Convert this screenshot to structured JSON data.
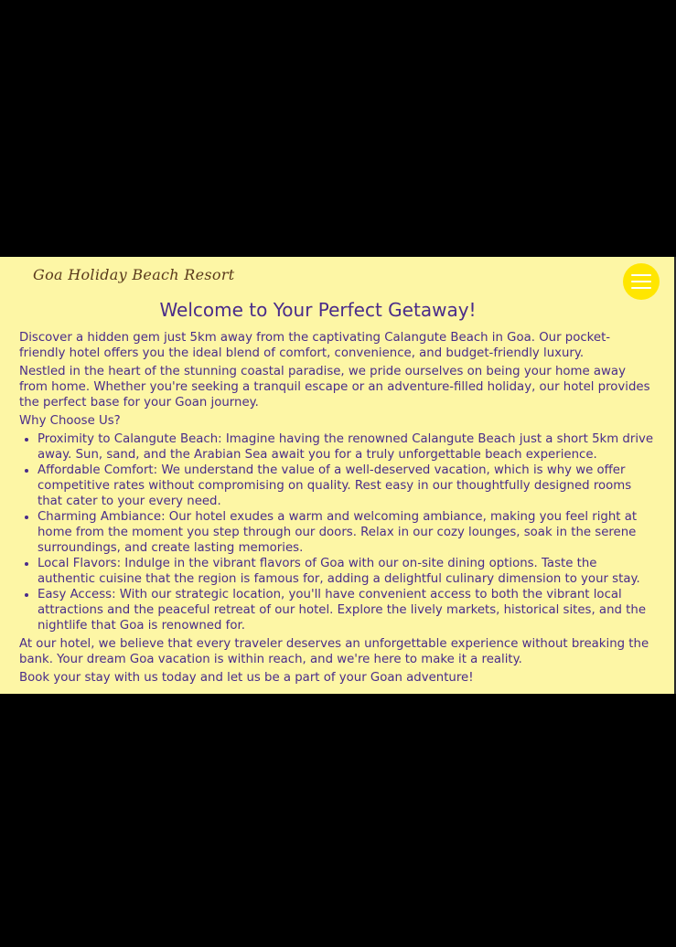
{
  "header": {
    "logo_text": "Goa Holiday Beach Resort",
    "menu_icon": "hamburger-menu-icon"
  },
  "main": {
    "title": "Welcome to Your Perfect Getaway!",
    "intro_1": "Discover a hidden gem just 5km away from the captivating Calangute Beach in Goa. Our pocket-friendly hotel offers you the ideal blend of comfort, convenience, and budget-friendly luxury.",
    "intro_2": "Nestled in the heart of the stunning coastal paradise, we pride ourselves on being your home away from home. Whether you're seeking a tranquil escape or an adventure-filled holiday, our hotel provides the perfect base for your Goan journey.",
    "why_heading": "Why Choose Us?",
    "features": [
      "Proximity to Calangute Beach: Imagine having the renowned Calangute Beach just a short 5km drive away. Sun, sand, and the Arabian Sea await you for a truly unforgettable beach experience.",
      "Affordable Comfort: We understand the value of a well-deserved vacation, which is why we offer competitive rates without compromising on quality. Rest easy in our thoughtfully designed rooms that cater to your every need.",
      "Charming Ambiance: Our hotel exudes a warm and welcoming ambiance, making you feel right at home from the moment you step through our doors. Relax in our cozy lounges, soak in the serene surroundings, and create lasting memories.",
      "Local Flavors: Indulge in the vibrant flavors of Goa with our on-site dining options. Taste the authentic cuisine that the region is famous for, adding a delightful culinary dimension to your stay.",
      "Easy Access: With our strategic location, you'll have convenient access to both the vibrant local attractions and the peaceful retreat of our hotel. Explore the lively markets, historical sites, and the nightlife that Goa is renowned for."
    ],
    "closing_1": "At our hotel, we believe that every traveler deserves an unforgettable experience without breaking the bank. Your dream Goa vacation is within reach, and we're here to make it a reality.",
    "closing_2": "Book your stay with us today and let us be a part of your Goan adventure!"
  },
  "colors": {
    "panel_background": "#fdf6a5",
    "text": "#4a2c8a",
    "menu_button": "#ffe600",
    "page_background": "#000000"
  }
}
